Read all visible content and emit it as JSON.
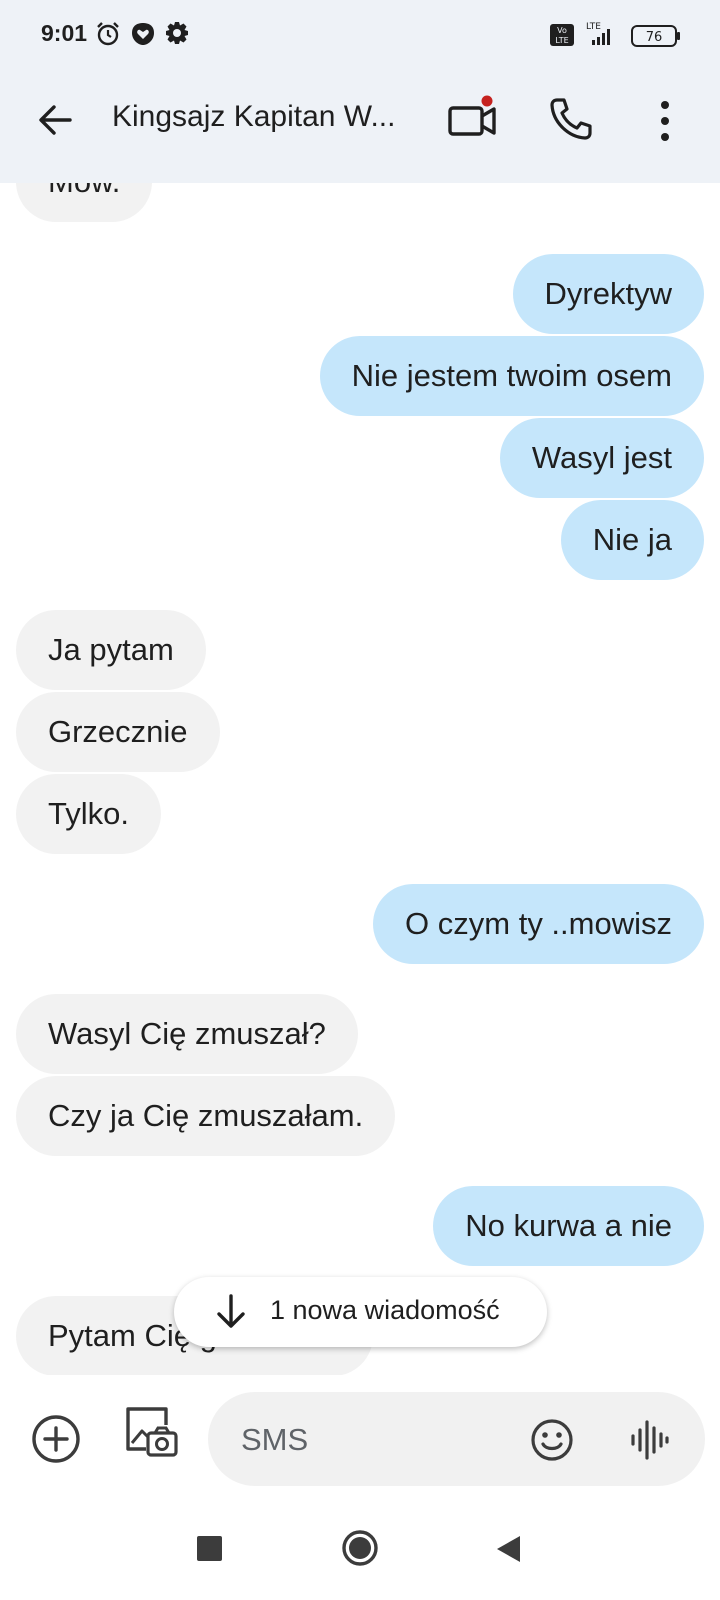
{
  "status_bar": {
    "time": "9:01",
    "battery": "76",
    "network_label": "LTE",
    "volte_label": "Vo LTE",
    "icons": [
      "alarm-icon",
      "heart-shield-icon",
      "gear-icon",
      "volte-icon",
      "signal-icon",
      "battery-icon"
    ]
  },
  "header": {
    "title": "Kingsajz Kapitan W...",
    "icons": [
      "back-arrow-icon",
      "video-call-icon",
      "phone-icon",
      "more-vert-icon"
    ],
    "notification_dot_color": "#c5221f"
  },
  "messages": [
    {
      "direction": "incoming",
      "text": "Mów."
    },
    {
      "direction": "outgoing",
      "text": "Dyrektyw"
    },
    {
      "direction": "outgoing",
      "text": "Nie jestem twoim osem"
    },
    {
      "direction": "outgoing",
      "text": "Wasyl jest"
    },
    {
      "direction": "outgoing",
      "text": "Nie ja"
    },
    {
      "direction": "incoming",
      "text": "Ja pytam"
    },
    {
      "direction": "incoming",
      "text": "Grzecznie"
    },
    {
      "direction": "incoming",
      "text": "Tylko."
    },
    {
      "direction": "outgoing",
      "text": "O czym ty ..mowisz"
    },
    {
      "direction": "incoming",
      "text": "Wasyl Cię zmuszał?"
    },
    {
      "direction": "incoming",
      "text": "Czy ja Cię zmuszałam."
    },
    {
      "direction": "outgoing",
      "text": "No kurwa a nie"
    },
    {
      "direction": "incoming",
      "text": "Pytam Cię grzecznie."
    }
  ],
  "new_message_pill": {
    "label": "1 nowa wiadomość"
  },
  "composer": {
    "placeholder": "SMS",
    "icons": [
      "add-circle-icon",
      "gallery-camera-icon",
      "emoji-icon",
      "voice-record-icon"
    ]
  },
  "colors": {
    "outgoing_bubble": "#c5e6fb",
    "incoming_bubble": "#f2f2f2",
    "header_bg": "#eef2f7"
  },
  "navbar": {
    "icons": [
      "recents-square-icon",
      "home-circle-icon",
      "back-triangle-icon"
    ]
  }
}
